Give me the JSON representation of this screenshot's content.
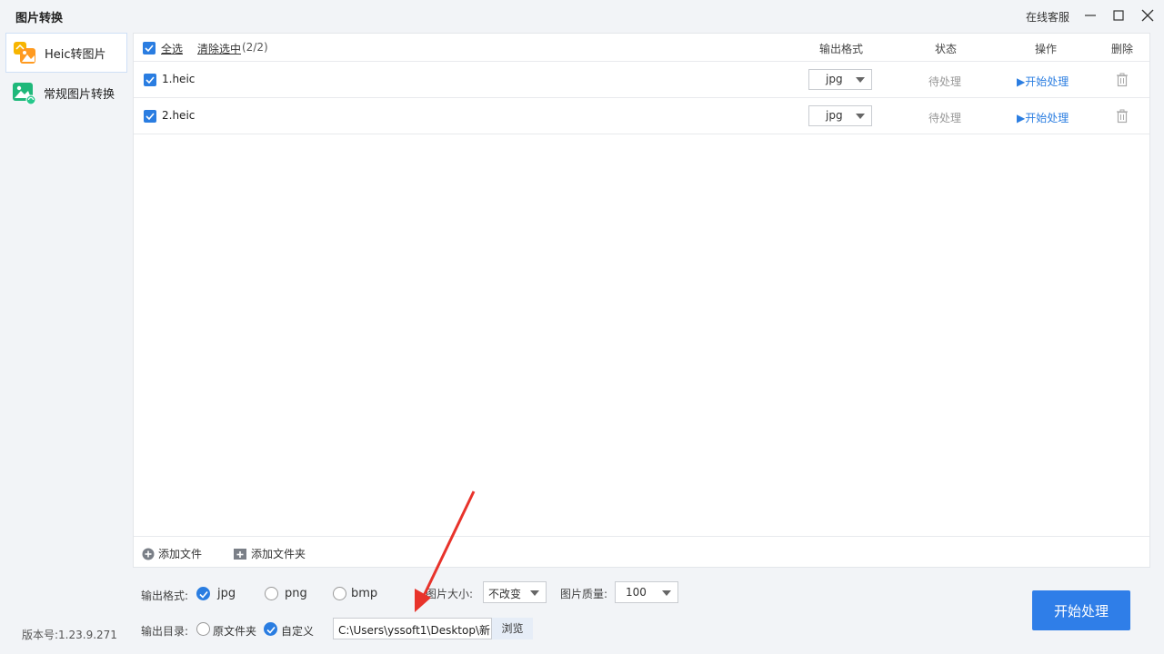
{
  "app": {
    "title": "图片转换",
    "service": "在线客服",
    "version": "版本号:1.23.9.271"
  },
  "sidebar": {
    "items": [
      {
        "label": "Heic转图片",
        "icon": "heic-image-icon",
        "active": true
      },
      {
        "label": "常规图片转换",
        "icon": "image-convert-icon",
        "active": false
      }
    ]
  },
  "list": {
    "select_all": "全选",
    "clear_selected": "清除选中",
    "selected_count": "(2/2)",
    "columns": {
      "format": "输出格式",
      "status": "状态",
      "action": "操作",
      "delete": "删除"
    },
    "rows": [
      {
        "name": "1.heic",
        "format": "jpg",
        "status": "待处理",
        "action": "开始处理",
        "checked": true
      },
      {
        "name": "2.heic",
        "format": "jpg",
        "status": "待处理",
        "action": "开始处理",
        "checked": true
      }
    ],
    "add_file": "添加文件",
    "add_folder": "添加文件夹"
  },
  "settings": {
    "format_label": "输出格式:",
    "formats": [
      {
        "label": "jpg",
        "selected": true
      },
      {
        "label": "png",
        "selected": false
      },
      {
        "label": "bmp",
        "selected": false
      }
    ],
    "size_label": "图片大小:",
    "size_value": "不改变",
    "quality_label": "图片质量:",
    "quality_value": "100",
    "output_dir_label": "输出目录:",
    "dir_options": [
      {
        "label": "原文件夹",
        "selected": false
      },
      {
        "label": "自定义",
        "selected": true
      }
    ],
    "output_path": "C:\\Users\\yssoft1\\Desktop\\新",
    "browse": "浏览",
    "start_button": "开始处理"
  },
  "colors": {
    "accent": "#2f7ee8",
    "annotation": "#e8332b"
  }
}
